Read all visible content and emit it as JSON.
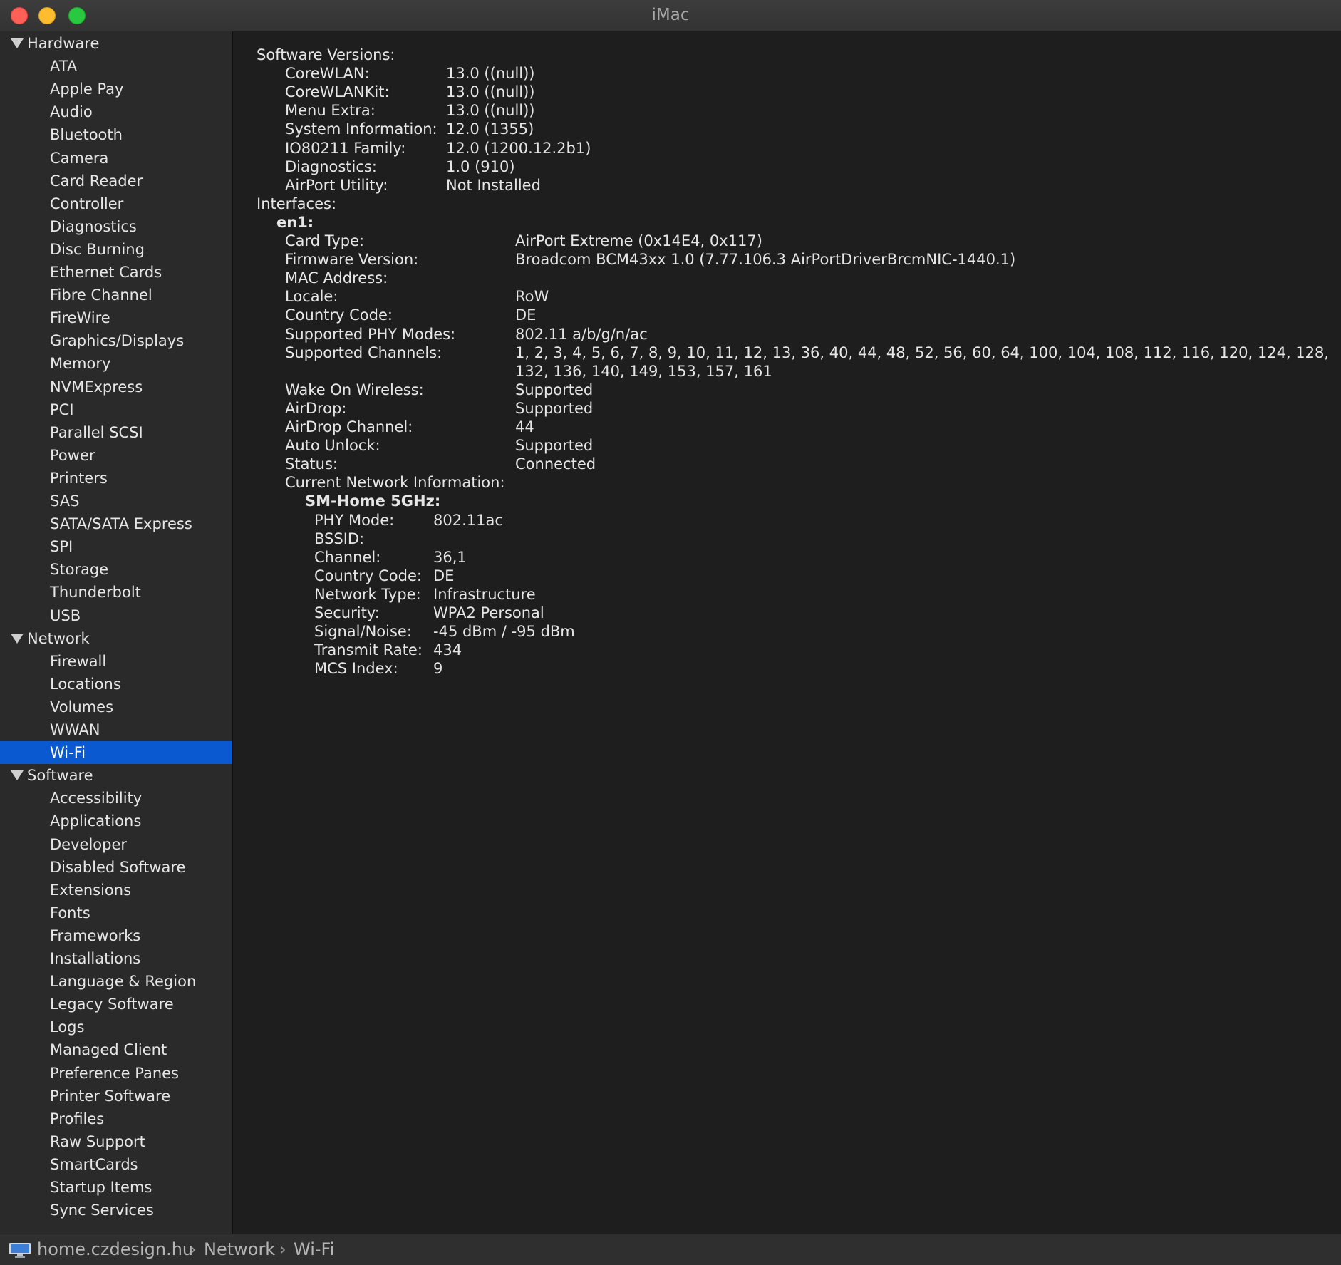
{
  "window": {
    "title": "iMac"
  },
  "sidebar": {
    "categories": [
      {
        "label": "Hardware",
        "items": [
          "ATA",
          "Apple Pay",
          "Audio",
          "Bluetooth",
          "Camera",
          "Card Reader",
          "Controller",
          "Diagnostics",
          "Disc Burning",
          "Ethernet Cards",
          "Fibre Channel",
          "FireWire",
          "Graphics/Displays",
          "Memory",
          "NVMExpress",
          "PCI",
          "Parallel SCSI",
          "Power",
          "Printers",
          "SAS",
          "SATA/SATA Express",
          "SPI",
          "Storage",
          "Thunderbolt",
          "USB"
        ]
      },
      {
        "label": "Network",
        "items": [
          "Firewall",
          "Locations",
          "Volumes",
          "WWAN",
          "Wi-Fi"
        ]
      },
      {
        "label": "Software",
        "items": [
          "Accessibility",
          "Applications",
          "Developer",
          "Disabled Software",
          "Extensions",
          "Fonts",
          "Frameworks",
          "Installations",
          "Language & Region",
          "Legacy Software",
          "Logs",
          "Managed Client",
          "Preference Panes",
          "Printer Software",
          "Profiles",
          "Raw Support",
          "SmartCards",
          "Startup Items",
          "Sync Services"
        ]
      }
    ],
    "selected": "Wi-Fi"
  },
  "content": {
    "software_versions_label": "Software Versions:",
    "software_versions": [
      {
        "key": "CoreWLAN:",
        "value": "13.0 ((null))"
      },
      {
        "key": "CoreWLANKit:",
        "value": "13.0 ((null))"
      },
      {
        "key": "Menu Extra:",
        "value": "13.0 ((null))"
      },
      {
        "key": "System Information:",
        "value": "12.0 (1355)"
      },
      {
        "key": "IO80211 Family:",
        "value": "12.0 (1200.12.2b1)"
      },
      {
        "key": "Diagnostics:",
        "value": "1.0 (910)"
      },
      {
        "key": "AirPort Utility:",
        "value": "Not Installed"
      }
    ],
    "interfaces_label": "Interfaces:",
    "interface_name": "en1:",
    "interface_fields": [
      {
        "key": "Card Type:",
        "value": "AirPort Extreme  (0x14E4, 0x117)"
      },
      {
        "key": "Firmware Version:",
        "value": "Broadcom BCM43xx 1.0 (7.77.106.3 AirPortDriverBrcmNIC-1440.1)"
      },
      {
        "key": "MAC Address:",
        "value": ""
      },
      {
        "key": "Locale:",
        "value": "RoW"
      },
      {
        "key": "Country Code:",
        "value": "DE"
      },
      {
        "key": "Supported PHY Modes:",
        "value": "802.11 a/b/g/n/ac"
      },
      {
        "key": "Supported Channels:",
        "value": "1, 2, 3, 4, 5, 6, 7, 8, 9, 10, 11, 12, 13, 36, 40, 44, 48, 52, 56, 60, 64, 100, 104, 108, 112, 116, 120, 124, 128,",
        "value2": "132, 136, 140, 149, 153, 157, 161"
      },
      {
        "key": "Wake On Wireless:",
        "value": "Supported"
      },
      {
        "key": "AirDrop:",
        "value": "Supported"
      },
      {
        "key": "AirDrop Channel:",
        "value": "44"
      },
      {
        "key": "Auto Unlock:",
        "value": "Supported"
      },
      {
        "key": "Status:",
        "value": "Connected"
      }
    ],
    "current_network_label": "Current Network Information:",
    "network_name": "SM-Home 5GHz:",
    "network_fields": [
      {
        "key": "PHY Mode:",
        "value": "802.11ac"
      },
      {
        "key": "BSSID:",
        "value": ""
      },
      {
        "key": "Channel:",
        "value": "36,1"
      },
      {
        "key": "Country Code:",
        "value": "DE"
      },
      {
        "key": "Network Type:",
        "value": "Infrastructure"
      },
      {
        "key": "Security:",
        "value": "WPA2 Personal"
      },
      {
        "key": "Signal/Noise:",
        "value": "-45 dBm / -95 dBm"
      },
      {
        "key": "Transmit Rate:",
        "value": "434"
      },
      {
        "key": "MCS Index:",
        "value": "9"
      }
    ]
  },
  "statusbar": {
    "icon": "imac-icon",
    "path": [
      "home.czdesign.hu",
      "Network",
      "Wi-Fi"
    ],
    "separator": "›"
  }
}
